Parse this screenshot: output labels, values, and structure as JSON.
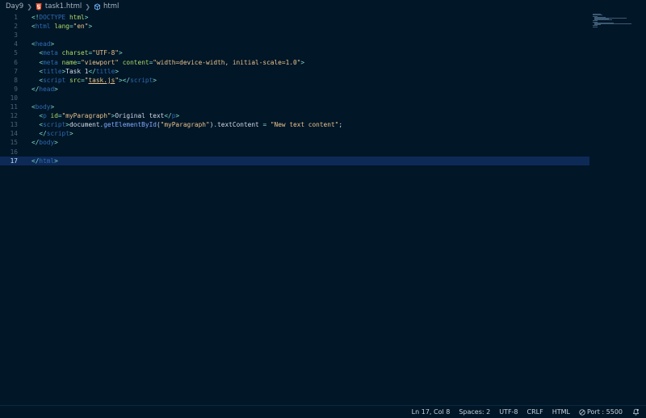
{
  "breadcrumb": {
    "folder": "Day9",
    "file": "task1.html",
    "symbol": "html"
  },
  "colors": {
    "background": "#011627",
    "current_line": "#0d2a57",
    "tag": "#2f6bb4",
    "attribute": "#addb67",
    "string": "#ecc48d",
    "punctuation": "#7fdbca",
    "text": "#d6deeb"
  },
  "editor": {
    "current_line": 17,
    "lines": [
      {
        "n": "1",
        "tokens": [
          [
            "<!",
            "punc"
          ],
          [
            "DOCTYPE",
            "dt"
          ],
          [
            " ",
            "text"
          ],
          [
            "html",
            "attr"
          ],
          [
            ">",
            "punc"
          ]
        ]
      },
      {
        "n": "2",
        "tokens": [
          [
            "<",
            "punc"
          ],
          [
            "html",
            "tag"
          ],
          [
            " ",
            "text"
          ],
          [
            "lang",
            "attr"
          ],
          [
            "=",
            "punc"
          ],
          [
            "\"en\"",
            "str"
          ],
          [
            ">",
            "punc"
          ]
        ]
      },
      {
        "n": "3",
        "tokens": []
      },
      {
        "n": "4",
        "tokens": [
          [
            "<",
            "punc"
          ],
          [
            "head",
            "tag"
          ],
          [
            ">",
            "punc"
          ]
        ]
      },
      {
        "n": "5",
        "tokens": [
          [
            "  ",
            "text"
          ],
          [
            "<",
            "punc"
          ],
          [
            "meta",
            "tag"
          ],
          [
            " ",
            "text"
          ],
          [
            "charset",
            "attr"
          ],
          [
            "=",
            "punc"
          ],
          [
            "\"UTF-8\"",
            "str"
          ],
          [
            ">",
            "punc"
          ]
        ]
      },
      {
        "n": "6",
        "tokens": [
          [
            "  ",
            "text"
          ],
          [
            "<",
            "punc"
          ],
          [
            "meta",
            "tag"
          ],
          [
            " ",
            "text"
          ],
          [
            "name",
            "attr"
          ],
          [
            "=",
            "punc"
          ],
          [
            "\"viewport\"",
            "str"
          ],
          [
            " ",
            "text"
          ],
          [
            "content",
            "attr"
          ],
          [
            "=",
            "punc"
          ],
          [
            "\"width=device-width, initial-scale=1.0\"",
            "str"
          ],
          [
            ">",
            "punc"
          ]
        ]
      },
      {
        "n": "7",
        "tokens": [
          [
            "  ",
            "text"
          ],
          [
            "<",
            "punc"
          ],
          [
            "title",
            "tag"
          ],
          [
            ">",
            "punc"
          ],
          [
            "Task 1",
            "text"
          ],
          [
            "</",
            "punc"
          ],
          [
            "title",
            "tag"
          ],
          [
            ">",
            "punc"
          ]
        ]
      },
      {
        "n": "8",
        "tokens": [
          [
            "  ",
            "text"
          ],
          [
            "<",
            "punc"
          ],
          [
            "script",
            "tag"
          ],
          [
            " ",
            "text"
          ],
          [
            "src",
            "attr"
          ],
          [
            "=",
            "punc"
          ],
          [
            "\"",
            "str"
          ],
          [
            "task.js",
            "link"
          ],
          [
            "\"",
            "str"
          ],
          [
            ">",
            "punc"
          ],
          [
            "</",
            "punc"
          ],
          [
            "script",
            "tag"
          ],
          [
            ">",
            "punc"
          ]
        ]
      },
      {
        "n": "9",
        "tokens": [
          [
            "</",
            "punc"
          ],
          [
            "head",
            "tag"
          ],
          [
            ">",
            "punc"
          ]
        ]
      },
      {
        "n": "10",
        "tokens": []
      },
      {
        "n": "11",
        "tokens": [
          [
            "<",
            "punc"
          ],
          [
            "body",
            "tag"
          ],
          [
            ">",
            "punc"
          ]
        ]
      },
      {
        "n": "12",
        "tokens": [
          [
            "  ",
            "text"
          ],
          [
            "<",
            "punc"
          ],
          [
            "p",
            "tag"
          ],
          [
            " ",
            "text"
          ],
          [
            "id",
            "attr"
          ],
          [
            "=",
            "punc"
          ],
          [
            "\"myParagraph\"",
            "str"
          ],
          [
            ">",
            "punc"
          ],
          [
            "Original text",
            "text"
          ],
          [
            "</",
            "punc"
          ],
          [
            "p",
            "tag"
          ],
          [
            ">",
            "punc"
          ]
        ]
      },
      {
        "n": "13",
        "tokens": [
          [
            "  ",
            "text"
          ],
          [
            "<",
            "punc"
          ],
          [
            "script",
            "tag"
          ],
          [
            ">",
            "punc"
          ],
          [
            "document",
            "text"
          ],
          [
            ".",
            "punc"
          ],
          [
            "getElementById",
            "fn"
          ],
          [
            "(",
            "text"
          ],
          [
            "\"myParagraph\"",
            "str"
          ],
          [
            ")",
            "text"
          ],
          [
            ".",
            "punc"
          ],
          [
            "textContent",
            "text"
          ],
          [
            " ",
            "text"
          ],
          [
            "=",
            "punc"
          ],
          [
            " ",
            "text"
          ],
          [
            "\"New text content\"",
            "str"
          ],
          [
            ";",
            "text"
          ]
        ]
      },
      {
        "n": "14",
        "tokens": [
          [
            "  ",
            "text"
          ],
          [
            "</",
            "punc"
          ],
          [
            "script",
            "tag"
          ],
          [
            ">",
            "punc"
          ]
        ]
      },
      {
        "n": "15",
        "tokens": [
          [
            "</",
            "punc"
          ],
          [
            "body",
            "tag"
          ],
          [
            ">",
            "punc"
          ]
        ]
      },
      {
        "n": "16",
        "tokens": []
      },
      {
        "n": "17",
        "tokens": [
          [
            "</",
            "punc"
          ],
          [
            "html",
            "tag"
          ],
          [
            ">",
            "punc"
          ]
        ]
      }
    ]
  },
  "statusbar": {
    "position": "Ln 17, Col 8",
    "spaces": "Spaces: 2",
    "encoding": "UTF-8",
    "eol": "CRLF",
    "language": "HTML",
    "port": "Port : 5500"
  },
  "icons": {
    "file": "html5-icon",
    "symbol": "cube-icon",
    "port": "port-icon",
    "notifications": "bell-icon"
  }
}
